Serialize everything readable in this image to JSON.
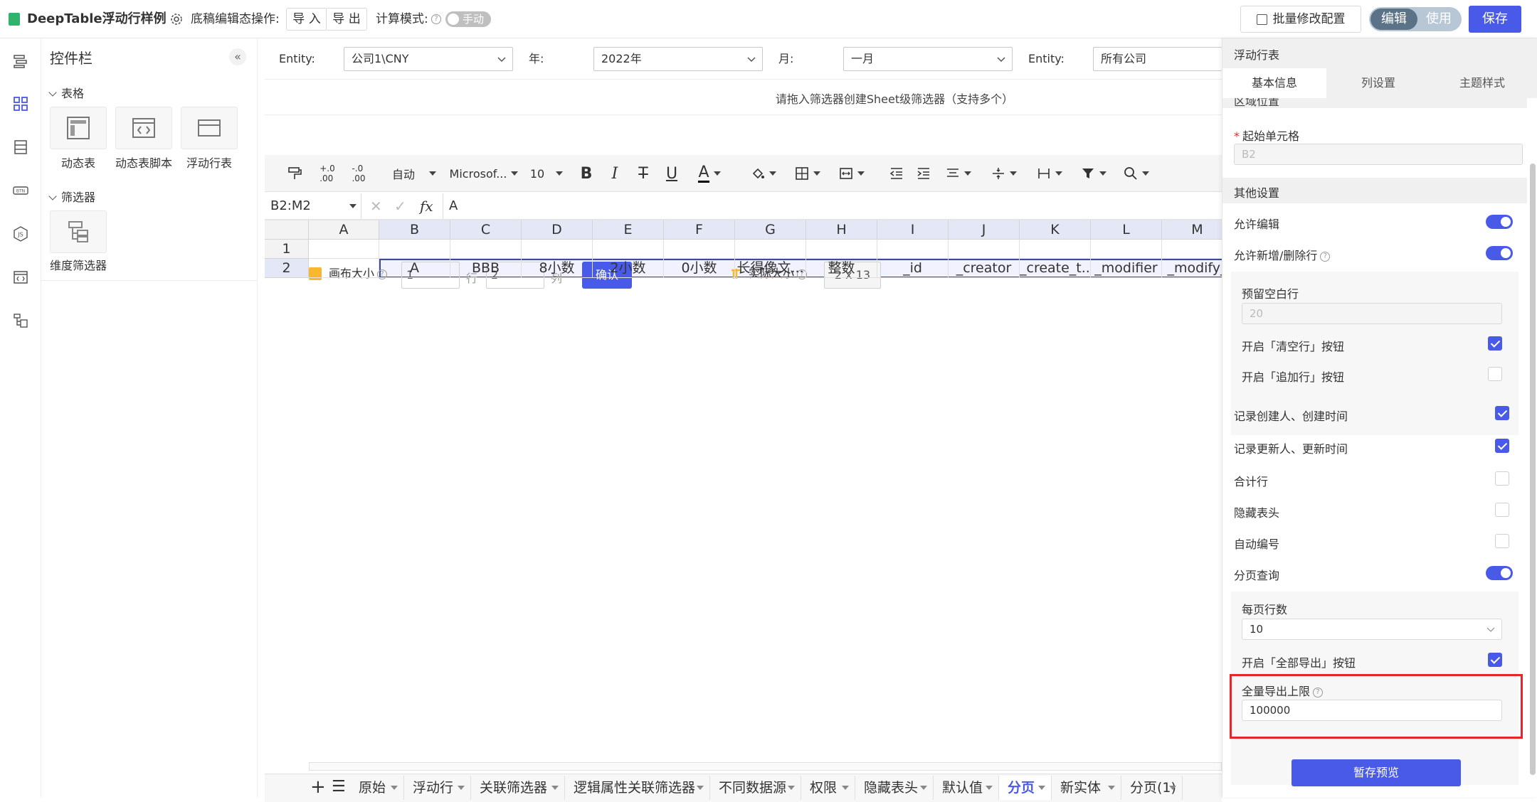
{
  "topbar": {
    "app_title": "DeepTable浮动行样例",
    "draft_ops_label": "底稿编辑态操作:",
    "import_label": "导 入",
    "export_label": "导 出",
    "calc_mode_label": "计算模式:",
    "calc_mode_value": "手动",
    "batch_modify_label": "批量修改配置",
    "mode_edit": "编辑",
    "mode_use": "使用",
    "save_label": "保存"
  },
  "widget_panel": {
    "title": "控件栏",
    "group_table": "表格",
    "table_items": [
      "动态表",
      "动态表脚本",
      "浮动行表"
    ],
    "group_filter": "筛选器",
    "filter_items": [
      "维度筛选器"
    ]
  },
  "filters": [
    {
      "label": "Entity:",
      "value": "公司1\\CNY"
    },
    {
      "label": "年:",
      "value": "2022年"
    },
    {
      "label": "月:",
      "value": "一月"
    },
    {
      "label": "Entity:",
      "value": "所有公司"
    }
  ],
  "drop_hint": "请拖入筛选器创建Sheet级筛选器（支持多个）",
  "toolbar": {
    "auto_label": "自动",
    "font_name": "Microsof...",
    "font_size": "10"
  },
  "formula_bar": {
    "cell_ref": "B2:M2",
    "fx": "fx",
    "value": "A"
  },
  "grid": {
    "columns": [
      "A",
      "B",
      "C",
      "D",
      "E",
      "F",
      "G",
      "H",
      "I",
      "J",
      "K",
      "L",
      "M"
    ],
    "row_numbers": [
      "1",
      "2"
    ],
    "row2": [
      "",
      "A",
      "BBB",
      "8小数",
      "2小数",
      "0小数",
      "长得像文...",
      "整数",
      "_id",
      "_creator",
      "_create_t...",
      "_modifier",
      "_modify_"
    ]
  },
  "canvas_size": {
    "label": "画布大小",
    "rows": "1",
    "rows_unit": "行",
    "cols": "2",
    "cols_unit": "列",
    "confirm_label": "确认",
    "actual_label": "实际大小",
    "actual_value": "2 x 13"
  },
  "sheet_tabs": [
    "原始",
    "浮动行",
    "关联筛选器",
    "逻辑属性关联筛选器",
    "不同数据源",
    "权限",
    "隐藏表头",
    "默认值",
    "分页",
    "新实体",
    "分页(1)"
  ],
  "active_sheet": "分页",
  "right_panel": {
    "title": "浮动行表",
    "tabs": [
      "基本信息",
      "列设置",
      "主题样式"
    ],
    "partial_header": "区域位置",
    "start_cell_label": "起始单元格",
    "start_cell_value": "B2",
    "other_settings": "其他设置",
    "allow_edit": "允许编辑",
    "allow_add_delete": "允许新增/删除行",
    "reserved_blank_rows": "预留空白行",
    "reserved_blank_rows_value": "20",
    "enable_clear_button": "开启「清空行」按钮",
    "enable_append_button": "开启「追加行」按钮",
    "record_creator": "记录创建人、创建时间",
    "record_modifier": "记录更新人、更新时间",
    "total_row": "合计行",
    "hide_header": "隐藏表头",
    "auto_number": "自动编号",
    "paged_query": "分页查询",
    "rows_per_page": "每页行数",
    "rows_per_page_value": "10",
    "enable_export_all": "开启「全部导出」按钮",
    "export_limit_label": "全量导出上限",
    "export_limit_value": "100000",
    "preview_label": "暂存预览"
  },
  "colors": {
    "accent": "#4a5ae8",
    "highlight_border": "#e5262b"
  }
}
